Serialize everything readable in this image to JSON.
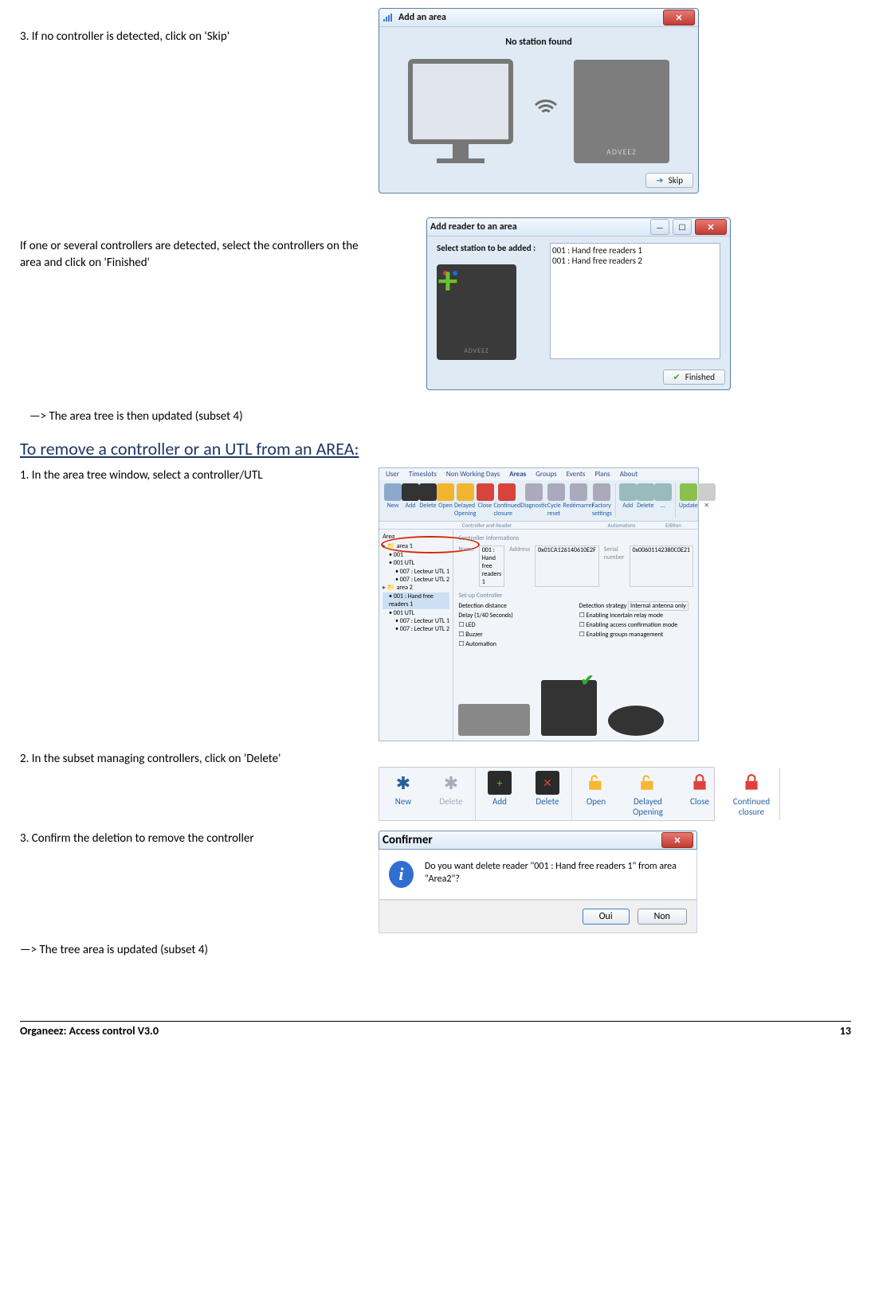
{
  "step3": {
    "text": "3. If no controller is detected, click on 'Skip'",
    "dialog": {
      "title": "Add an area",
      "message": "No station found",
      "brand": "ADVEEZ",
      "skip": "Skip"
    }
  },
  "detected": {
    "text": "If one or several controllers are detected, select the controllers on the area and click on 'Finished'",
    "dialog": {
      "title": "Add reader to an area",
      "prompt": "Select station to be added :",
      "items": [
        "001 : Hand free readers 1",
        "001 : Hand free readers 2"
      ],
      "brand": "ADVEEZ",
      "finished": "Finished"
    }
  },
  "note1": "—> The area tree is then updated (subset 4)",
  "heading": "To remove a controller or an UTL from an AREA:",
  "removeStep1": {
    "text": "1. In the area tree window, select a controller/UTL",
    "ribbon_tabs": [
      "User",
      "Timeslots",
      "Non Working Days",
      "Areas",
      "Groups",
      "Events",
      "Plans",
      "About"
    ],
    "ribbon_groups": [
      [
        "New",
        "Add",
        "Delete",
        "Open",
        "Delayed Opening",
        "Close",
        "Continued closure",
        "Diagnostic",
        "Cycle reset",
        "Redémarrer",
        "Factory settings"
      ],
      [
        "Add",
        "Delete",
        "…"
      ],
      [
        "Update",
        "✕"
      ]
    ],
    "group_labels": [
      "Controller and Reader",
      "Automatons",
      "Edition"
    ],
    "tree_root": "Area",
    "tree": [
      "📁 area 1",
      "  • 001",
      "  • 001 UTL",
      "    • 007 : Lecteur UTL 1",
      "    • 007 : Lecteur UTL 2",
      "📁 area 2",
      "  • 001 : Hand free readers 1",
      "  • 001 UTL",
      "    • 007 : Lecteur UTL 1",
      "    • 007 : Lecteur UTL 2"
    ],
    "panel": {
      "section": "Controller informations",
      "name_val": "001 : Hand free readers 1",
      "addr_val": "0x01CA126140610E2F",
      "serial_val": "0x00601142380C0E21",
      "setup": "Set-up Controller",
      "rows": [
        {
          "left": "Detection distance",
          "right": "Detection strategy",
          "right_val": "Internal antenna only"
        },
        {
          "left": "Delay (1/40 Seconds)",
          "right_cb": "Enabling incertain relay mode"
        },
        {
          "left_cb": "LED",
          "right_cb": "Enabling access confirmation mode"
        },
        {
          "left_cb": "Buzzer",
          "right_cb": "Enabling groups management"
        },
        {
          "left_cb": "Automation"
        }
      ]
    }
  },
  "removeStep2": {
    "text": "2. In the subset managing controllers, click on 'Delete'",
    "items": [
      {
        "label": "New",
        "color": "#285e9b",
        "glyph": "net"
      },
      {
        "label": "Delete",
        "color": "#9aa6b3",
        "glyph": "net-x"
      },
      {
        "label": "Add",
        "color": "#2a2a2a",
        "glyph": "dev+"
      },
      {
        "label": "Delete",
        "color": "#2a2a2a",
        "glyph": "dev-x"
      },
      {
        "label": "Open",
        "color": "#f7b731",
        "glyph": "lock-open"
      },
      {
        "label": "Delayed Opening",
        "color": "#f7b731",
        "glyph": "lock-open"
      },
      {
        "label": "Close",
        "color": "#e0423b",
        "glyph": "lock-closed"
      },
      {
        "label": "Continued closure",
        "color": "#e0423b",
        "glyph": "lock-closed"
      }
    ]
  },
  "removeStep3": {
    "text": "3. Confirm the deletion to remove the controller",
    "dialog": {
      "title": "Confirmer",
      "message": "Do you want delete reader \"001 : Hand free readers 1\" from area \"Area2\"?",
      "yes": "Oui",
      "no": "Non"
    }
  },
  "note2": "—> The tree area is updated (subset 4)",
  "footer": {
    "left": "Organeez: Access control     V3.0",
    "page": "13"
  }
}
